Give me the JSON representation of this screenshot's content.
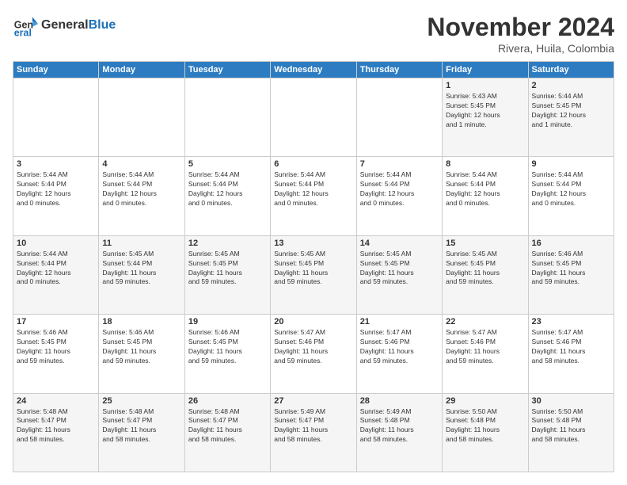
{
  "header": {
    "logo_general": "General",
    "logo_blue": "Blue",
    "month_title": "November 2024",
    "location": "Rivera, Huila, Colombia"
  },
  "weekdays": [
    "Sunday",
    "Monday",
    "Tuesday",
    "Wednesday",
    "Thursday",
    "Friday",
    "Saturday"
  ],
  "weeks": [
    [
      {
        "day": "",
        "info": ""
      },
      {
        "day": "",
        "info": ""
      },
      {
        "day": "",
        "info": ""
      },
      {
        "day": "",
        "info": ""
      },
      {
        "day": "",
        "info": ""
      },
      {
        "day": "1",
        "info": "Sunrise: 5:43 AM\nSunset: 5:45 PM\nDaylight: 12 hours\nand 1 minute."
      },
      {
        "day": "2",
        "info": "Sunrise: 5:44 AM\nSunset: 5:45 PM\nDaylight: 12 hours\nand 1 minute."
      }
    ],
    [
      {
        "day": "3",
        "info": "Sunrise: 5:44 AM\nSunset: 5:44 PM\nDaylight: 12 hours\nand 0 minutes."
      },
      {
        "day": "4",
        "info": "Sunrise: 5:44 AM\nSunset: 5:44 PM\nDaylight: 12 hours\nand 0 minutes."
      },
      {
        "day": "5",
        "info": "Sunrise: 5:44 AM\nSunset: 5:44 PM\nDaylight: 12 hours\nand 0 minutes."
      },
      {
        "day": "6",
        "info": "Sunrise: 5:44 AM\nSunset: 5:44 PM\nDaylight: 12 hours\nand 0 minutes."
      },
      {
        "day": "7",
        "info": "Sunrise: 5:44 AM\nSunset: 5:44 PM\nDaylight: 12 hours\nand 0 minutes."
      },
      {
        "day": "8",
        "info": "Sunrise: 5:44 AM\nSunset: 5:44 PM\nDaylight: 12 hours\nand 0 minutes."
      },
      {
        "day": "9",
        "info": "Sunrise: 5:44 AM\nSunset: 5:44 PM\nDaylight: 12 hours\nand 0 minutes."
      }
    ],
    [
      {
        "day": "10",
        "info": "Sunrise: 5:44 AM\nSunset: 5:44 PM\nDaylight: 12 hours\nand 0 minutes."
      },
      {
        "day": "11",
        "info": "Sunrise: 5:45 AM\nSunset: 5:44 PM\nDaylight: 11 hours\nand 59 minutes."
      },
      {
        "day": "12",
        "info": "Sunrise: 5:45 AM\nSunset: 5:45 PM\nDaylight: 11 hours\nand 59 minutes."
      },
      {
        "day": "13",
        "info": "Sunrise: 5:45 AM\nSunset: 5:45 PM\nDaylight: 11 hours\nand 59 minutes."
      },
      {
        "day": "14",
        "info": "Sunrise: 5:45 AM\nSunset: 5:45 PM\nDaylight: 11 hours\nand 59 minutes."
      },
      {
        "day": "15",
        "info": "Sunrise: 5:45 AM\nSunset: 5:45 PM\nDaylight: 11 hours\nand 59 minutes."
      },
      {
        "day": "16",
        "info": "Sunrise: 5:46 AM\nSunset: 5:45 PM\nDaylight: 11 hours\nand 59 minutes."
      }
    ],
    [
      {
        "day": "17",
        "info": "Sunrise: 5:46 AM\nSunset: 5:45 PM\nDaylight: 11 hours\nand 59 minutes."
      },
      {
        "day": "18",
        "info": "Sunrise: 5:46 AM\nSunset: 5:45 PM\nDaylight: 11 hours\nand 59 minutes."
      },
      {
        "day": "19",
        "info": "Sunrise: 5:46 AM\nSunset: 5:45 PM\nDaylight: 11 hours\nand 59 minutes."
      },
      {
        "day": "20",
        "info": "Sunrise: 5:47 AM\nSunset: 5:46 PM\nDaylight: 11 hours\nand 59 minutes."
      },
      {
        "day": "21",
        "info": "Sunrise: 5:47 AM\nSunset: 5:46 PM\nDaylight: 11 hours\nand 59 minutes."
      },
      {
        "day": "22",
        "info": "Sunrise: 5:47 AM\nSunset: 5:46 PM\nDaylight: 11 hours\nand 59 minutes."
      },
      {
        "day": "23",
        "info": "Sunrise: 5:47 AM\nSunset: 5:46 PM\nDaylight: 11 hours\nand 58 minutes."
      }
    ],
    [
      {
        "day": "24",
        "info": "Sunrise: 5:48 AM\nSunset: 5:47 PM\nDaylight: 11 hours\nand 58 minutes."
      },
      {
        "day": "25",
        "info": "Sunrise: 5:48 AM\nSunset: 5:47 PM\nDaylight: 11 hours\nand 58 minutes."
      },
      {
        "day": "26",
        "info": "Sunrise: 5:48 AM\nSunset: 5:47 PM\nDaylight: 11 hours\nand 58 minutes."
      },
      {
        "day": "27",
        "info": "Sunrise: 5:49 AM\nSunset: 5:47 PM\nDaylight: 11 hours\nand 58 minutes."
      },
      {
        "day": "28",
        "info": "Sunrise: 5:49 AM\nSunset: 5:48 PM\nDaylight: 11 hours\nand 58 minutes."
      },
      {
        "day": "29",
        "info": "Sunrise: 5:50 AM\nSunset: 5:48 PM\nDaylight: 11 hours\nand 58 minutes."
      },
      {
        "day": "30",
        "info": "Sunrise: 5:50 AM\nSunset: 5:48 PM\nDaylight: 11 hours\nand 58 minutes."
      }
    ]
  ]
}
